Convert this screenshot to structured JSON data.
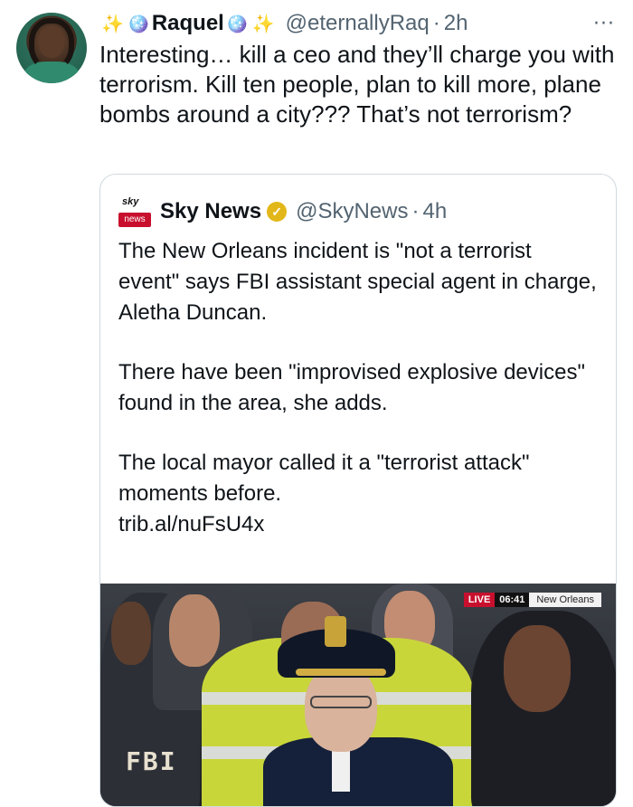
{
  "tweet": {
    "display_name": "Raquel",
    "name_emojis_left": "✨",
    "name_emoji_disco": "🪩",
    "name_emojis_right": "✨",
    "handle": "@eternallyRaq",
    "separator": "·",
    "time": "2h",
    "more_icon": "···",
    "text": "Interesting… kill a ceo and they’ll charge you with terrorism. Kill ten people, plan to kill more, plane bombs around a city??? That’s not terrorism?"
  },
  "quoted": {
    "logo_top": "sky",
    "logo_bottom": "news",
    "display_name": "Sky News",
    "verified_icon": "✓",
    "handle": "@SkyNews",
    "separator": "·",
    "time": "4h",
    "paragraphs": [
      "The New Orleans incident is \"not a terrorist event\" says FBI assistant special agent in charge, Aletha Duncan.",
      "There have been \"improvised explosive devices\" found in the area, she adds.",
      "The local mayor called it a \"terrorist attack\" moments before."
    ],
    "link": "trib.al/nuFsU4x",
    "media": {
      "live_label": "LIVE",
      "clock": "06:41",
      "location": "New Orleans",
      "jacket_text": "FBI"
    }
  },
  "colors": {
    "text": "#0f1419",
    "secondary": "#536471",
    "border": "#cfd9de",
    "sky_red": "#c8102e",
    "verified_gold": "#e2b719"
  }
}
